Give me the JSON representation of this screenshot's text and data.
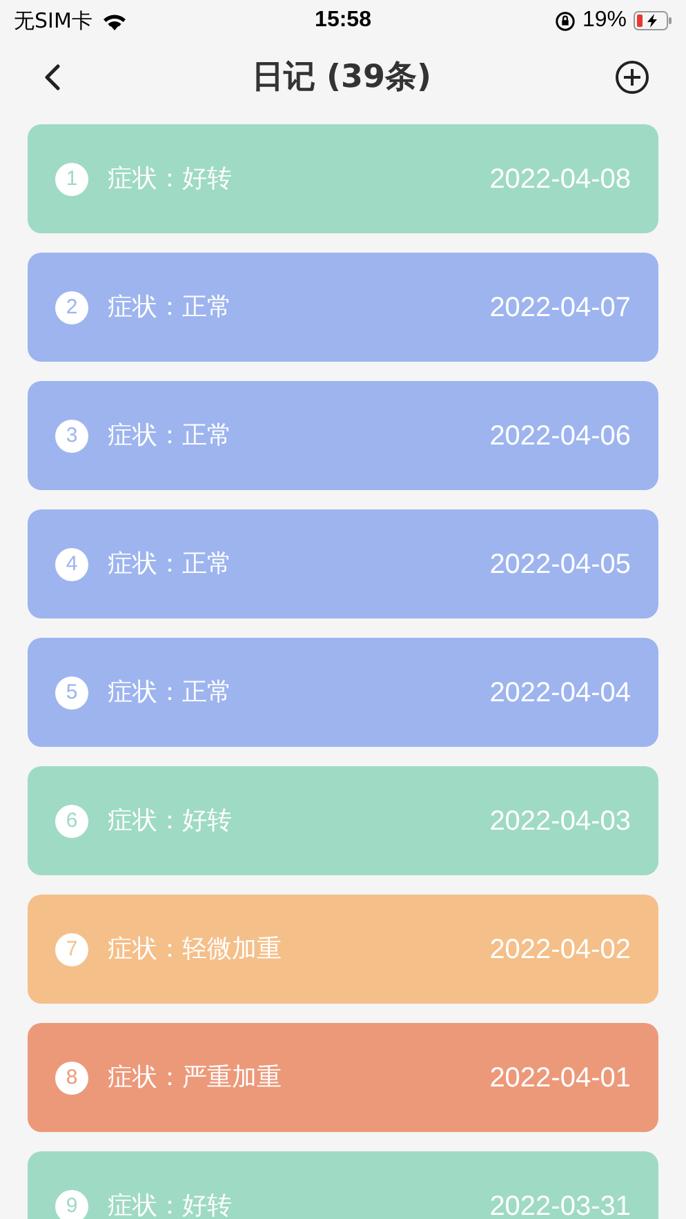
{
  "status_bar": {
    "carrier": "无SIM卡",
    "time": "15:58",
    "battery": "19%"
  },
  "header": {
    "title": "日记 (39条)"
  },
  "entries": [
    {
      "number": "1",
      "symptom": "症状：好转",
      "date": "2022-04-08",
      "color": "#9fdac4"
    },
    {
      "number": "2",
      "symptom": "症状：正常",
      "date": "2022-04-07",
      "color": "#9db4ef"
    },
    {
      "number": "3",
      "symptom": "症状：正常",
      "date": "2022-04-06",
      "color": "#9db4ef"
    },
    {
      "number": "4",
      "symptom": "症状：正常",
      "date": "2022-04-05",
      "color": "#9db4ef"
    },
    {
      "number": "5",
      "symptom": "症状：正常",
      "date": "2022-04-04",
      "color": "#9db4ef"
    },
    {
      "number": "6",
      "symptom": "症状：好转",
      "date": "2022-04-03",
      "color": "#9fdac4"
    },
    {
      "number": "7",
      "symptom": "症状：轻微加重",
      "date": "2022-04-02",
      "color": "#f5bf89"
    },
    {
      "number": "8",
      "symptom": "症状：严重加重",
      "date": "2022-04-01",
      "color": "#ec997a"
    },
    {
      "number": "9",
      "symptom": "症状：好转",
      "date": "2022-03-31",
      "color": "#9fdac4"
    }
  ]
}
